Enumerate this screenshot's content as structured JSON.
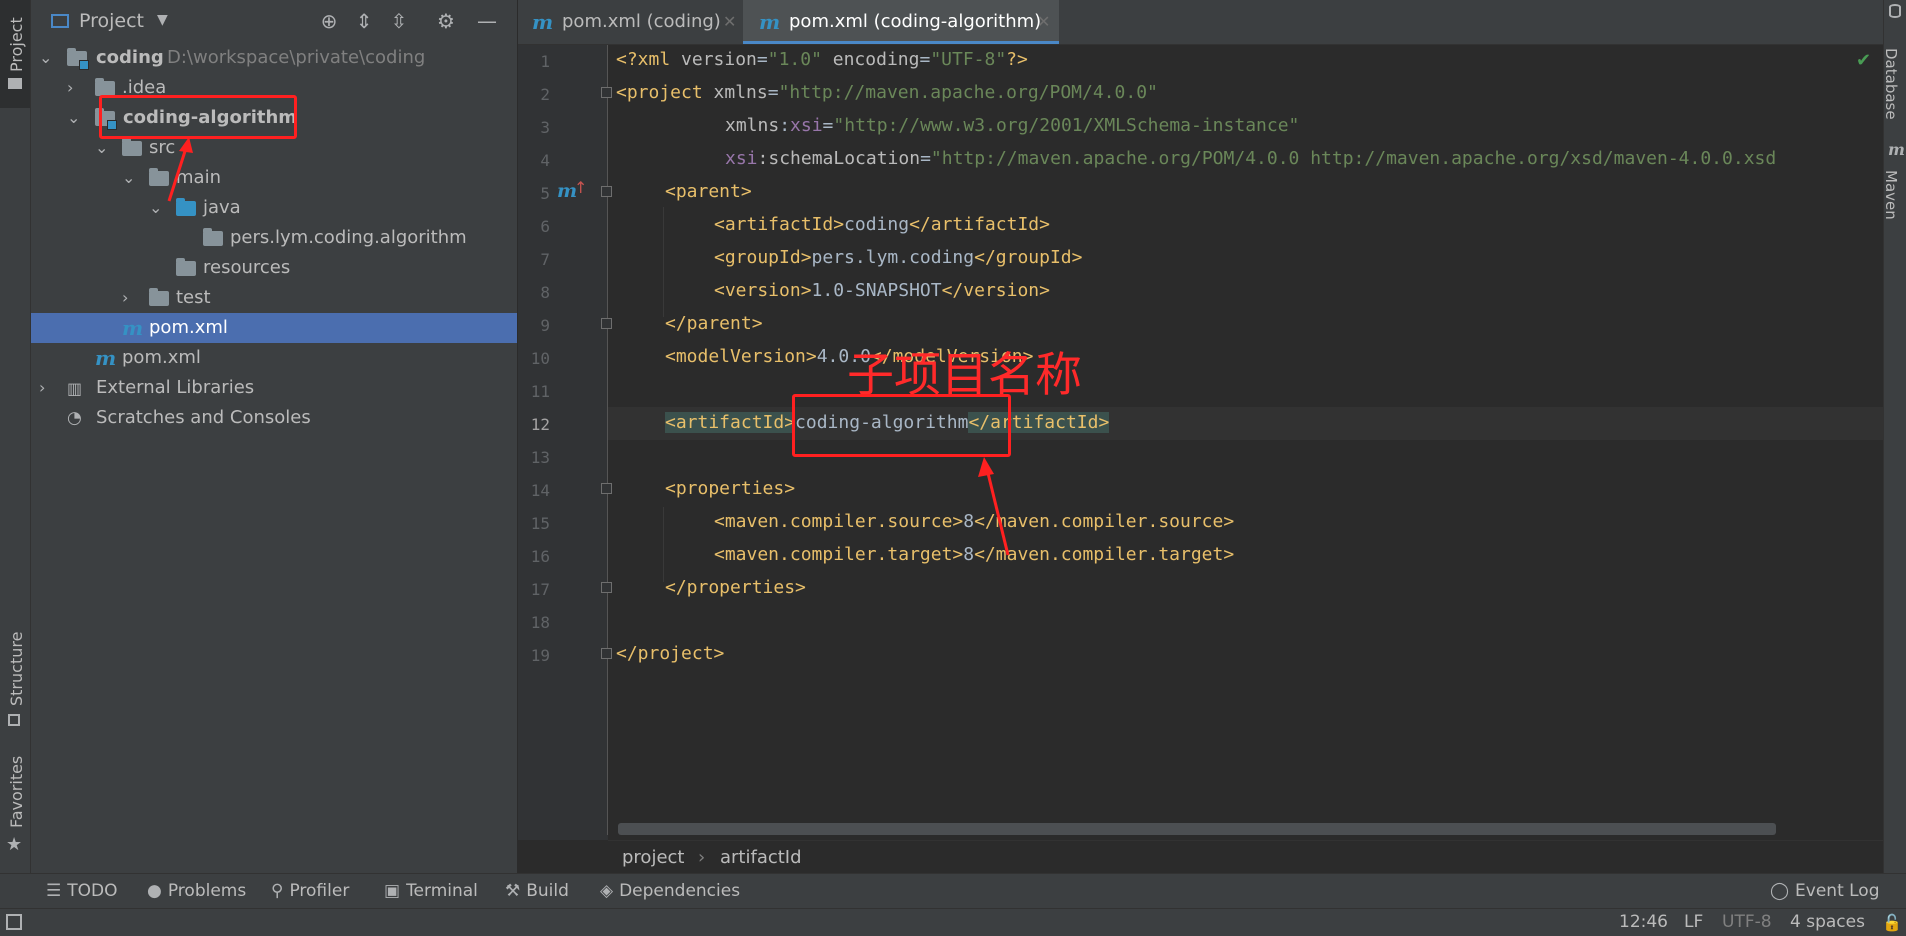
{
  "left_strip": {
    "project": "Project",
    "structure": "Structure",
    "favorites": "Favorites"
  },
  "right_strip": {
    "database": "Database",
    "maven": "Maven"
  },
  "project_panel": {
    "title": "Project",
    "tree": [
      {
        "label": "coding",
        "path": "D:\\workspace\\private\\coding"
      },
      {
        "label": ".idea"
      },
      {
        "label": "coding-algorithm"
      },
      {
        "label": "src"
      },
      {
        "label": "main"
      },
      {
        "label": "java"
      },
      {
        "label": "pers.lym.coding.algorithm"
      },
      {
        "label": "resources"
      },
      {
        "label": "test"
      },
      {
        "label": "pom.xml"
      },
      {
        "label": "pom.xml"
      },
      {
        "label": "External Libraries"
      },
      {
        "label": "Scratches and Consoles"
      }
    ]
  },
  "tabs": [
    {
      "label": "pom.xml (coding)",
      "active": false
    },
    {
      "label": "pom.xml (coding-algorithm)",
      "active": true
    }
  ],
  "line_numbers": [
    "1",
    "2",
    "3",
    "4",
    "5",
    "6",
    "7",
    "8",
    "9",
    "10",
    "11",
    "12",
    "13",
    "14",
    "15",
    "16",
    "17",
    "18",
    "19"
  ],
  "code": {
    "l1": {
      "a": "<?xml ",
      "b": "version",
      "c": "=",
      "d": "\"1.0\"",
      "e": " encoding",
      "f": "=",
      "g": "\"UTF-8\"",
      "h": "?>"
    },
    "l2": {
      "a": "<project ",
      "b": "xmlns",
      "c": "=",
      "d": "\"http://maven.apache.org/POM/4.0.0\""
    },
    "l3": {
      "a": "xmlns",
      "b": ":",
      "c": "xsi",
      "d": "=",
      "e": "\"http://www.w3.org/2001/XMLSchema-instance\""
    },
    "l4": {
      "a": "xsi",
      "b": ":schemaLocation",
      "c": "=",
      "d": "\"http://maven.apache.org/POM/4.0.0 http://maven.apache.org/xsd/maven-4.0.0.xsd"
    },
    "l5": "<parent>",
    "l6": {
      "open": "<artifactId>",
      "val": "coding",
      "close": "</artifactId>"
    },
    "l7": {
      "open": "<groupId>",
      "val": "pers.lym.coding",
      "close": "</groupId>"
    },
    "l8": {
      "open": "<version>",
      "val": "1.0-SNAPSHOT",
      "close": "</version>"
    },
    "l9": "</parent>",
    "l10": {
      "open": "<modelVersion>",
      "val": "4.0.0",
      "close": "</modelVersion>"
    },
    "l12": {
      "open": "<artifactId>",
      "val": "coding-algorithm",
      "close": "</artifactId>"
    },
    "l14": "<properties>",
    "l15": {
      "open": "<maven.compiler.source>",
      "val": "8",
      "close": "</maven.compiler.source>"
    },
    "l16": {
      "open": "<maven.compiler.target>",
      "val": "8",
      "close": "</maven.compiler.target>"
    },
    "l17": "</properties>",
    "l19": "</project>"
  },
  "annotation": {
    "text": "子项目名称"
  },
  "breadcrumbs": {
    "first": "project",
    "sep": "›",
    "second": "artifactId"
  },
  "tool_windows": {
    "todo": "TODO",
    "problems": "Problems",
    "profiler": "Profiler",
    "terminal": "Terminal",
    "build": "Build",
    "dependencies": "Dependencies",
    "event_log": "Event Log"
  },
  "status": {
    "position": "12:46",
    "line_sep": "LF",
    "encoding": "UTF-8",
    "indent": "4 spaces"
  },
  "icons": {
    "check": "✔",
    "gear": "⚙",
    "lock": "lock-icon"
  },
  "colors": {
    "selection": "#4b6eaf",
    "annotation": "#ff2020",
    "tag": "#e8bf6a",
    "string": "#6a8759"
  }
}
